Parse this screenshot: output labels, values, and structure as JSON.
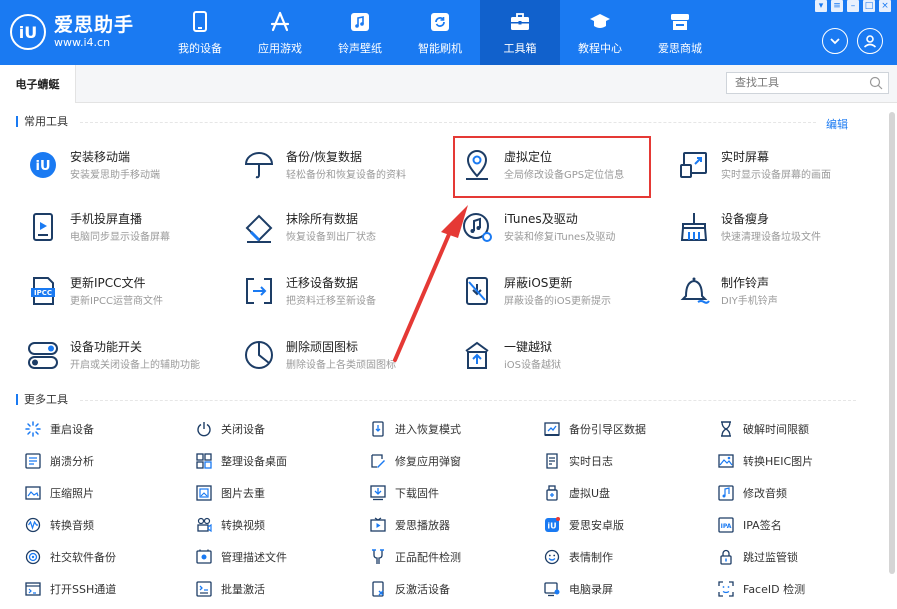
{
  "app": {
    "logo_mark": "iU",
    "logo_name": "爱思助手",
    "logo_url": "www.i4.cn"
  },
  "nav": [
    {
      "label": "我的设备",
      "icon": "phone-icon"
    },
    {
      "label": "应用游戏",
      "icon": "apps-icon"
    },
    {
      "label": "铃声壁纸",
      "icon": "music-icon"
    },
    {
      "label": "智能刷机",
      "icon": "refresh-icon"
    },
    {
      "label": "工具箱",
      "icon": "toolbox-icon",
      "active": true
    },
    {
      "label": "教程中心",
      "icon": "graduation-cap-icon"
    },
    {
      "label": "爱思商城",
      "icon": "store-icon"
    }
  ],
  "tabs": {
    "active": "电子蜻蜓"
  },
  "search": {
    "placeholder": "查找工具"
  },
  "common": {
    "title": "常用工具",
    "edit": "编辑",
    "tools": [
      {
        "name": "安装移动端",
        "desc": "安装爱思助手移动端",
        "icon": "i4-app-icon"
      },
      {
        "name": "备份/恢复数据",
        "desc": "轻松备份和恢复设备的资料",
        "icon": "umbrella-icon"
      },
      {
        "name": "虚拟定位",
        "desc": "全局修改设备GPS定位信息",
        "icon": "location-pin-icon"
      },
      {
        "name": "实时屏幕",
        "desc": "实时显示设备屏幕的画面",
        "icon": "screen-mirror-icon"
      },
      {
        "name": "手机投屏直播",
        "desc": "电脑同步显示设备屏幕",
        "icon": "play-screen-icon"
      },
      {
        "name": "抹除所有数据",
        "desc": "恢复设备到出厂状态",
        "icon": "eraser-icon"
      },
      {
        "name": "iTunes及驱动",
        "desc": "安装和修复iTunes及驱动",
        "icon": "itunes-icon"
      },
      {
        "name": "设备瘦身",
        "desc": "快速清理设备垃圾文件",
        "icon": "broom-icon"
      },
      {
        "name": "更新IPCC文件",
        "desc": "更新IPCC运营商文件",
        "icon": "ipcc-icon"
      },
      {
        "name": "迁移设备数据",
        "desc": "把资料迁移至新设备",
        "icon": "migrate-icon"
      },
      {
        "name": "屏蔽iOS更新",
        "desc": "屏蔽设备的iOS更新提示",
        "icon": "block-update-icon"
      },
      {
        "name": "制作铃声",
        "desc": "DIY手机铃声",
        "icon": "bell-icon"
      },
      {
        "name": "设备功能开关",
        "desc": "开启或关闭设备上的辅助功能",
        "icon": "toggle-icon"
      },
      {
        "name": "删除顽固图标",
        "desc": "删除设备上各类顽固图标",
        "icon": "pie-clock-icon"
      },
      {
        "name": "一键越狱",
        "desc": "iOS设备越狱",
        "icon": "jailbreak-icon"
      }
    ]
  },
  "more": {
    "title": "更多工具",
    "tools": [
      {
        "label": "重启设备",
        "icon": "restart-icon"
      },
      {
        "label": "关闭设备",
        "icon": "power-icon"
      },
      {
        "label": "进入恢复模式",
        "icon": "recovery-mode-icon"
      },
      {
        "label": "备份引导区数据",
        "icon": "backup-boot-icon"
      },
      {
        "label": "破解时间限额",
        "icon": "hourglass-icon"
      },
      {
        "label": "崩溃分析",
        "icon": "crash-analysis-icon"
      },
      {
        "label": "整理设备桌面",
        "icon": "grid-icon"
      },
      {
        "label": "修复应用弹窗",
        "icon": "repair-popup-icon"
      },
      {
        "label": "实时日志",
        "icon": "log-icon"
      },
      {
        "label": "转换HEIC图片",
        "icon": "heic-icon"
      },
      {
        "label": "压缩照片",
        "icon": "compress-photo-icon"
      },
      {
        "label": "图片去重",
        "icon": "dedupe-photo-icon"
      },
      {
        "label": "下载固件",
        "icon": "download-firmware-icon"
      },
      {
        "label": "虚拟U盘",
        "icon": "usb-drive-icon"
      },
      {
        "label": "修改音频",
        "icon": "audio-edit-icon"
      },
      {
        "label": "转换音频",
        "icon": "audio-convert-icon"
      },
      {
        "label": "转换视频",
        "icon": "video-convert-icon"
      },
      {
        "label": "爱思播放器",
        "icon": "player-icon"
      },
      {
        "label": "爱思安卓版",
        "icon": "android-app-icon"
      },
      {
        "label": "IPA签名",
        "icon": "ipa-sign-icon"
      },
      {
        "label": "社交软件备份",
        "icon": "social-backup-icon"
      },
      {
        "label": "管理描述文件",
        "icon": "profile-manage-icon"
      },
      {
        "label": "正品配件检测",
        "icon": "accessory-check-icon"
      },
      {
        "label": "表情制作",
        "icon": "emoji-icon"
      },
      {
        "label": "跳过监管锁",
        "icon": "skip-lock-icon"
      },
      {
        "label": "打开SSH通道",
        "icon": "ssh-terminal-icon"
      },
      {
        "label": "批量激活",
        "icon": "batch-activate-icon"
      },
      {
        "label": "反激活设备",
        "icon": "deactivate-icon"
      },
      {
        "label": "电脑录屏",
        "icon": "screen-record-icon"
      },
      {
        "label": "FaceID 检测",
        "icon": "faceid-icon"
      }
    ]
  },
  "colors": {
    "brand": "#1a7af2",
    "brand_dark": "#1161cc",
    "highlight": "#e53935"
  }
}
